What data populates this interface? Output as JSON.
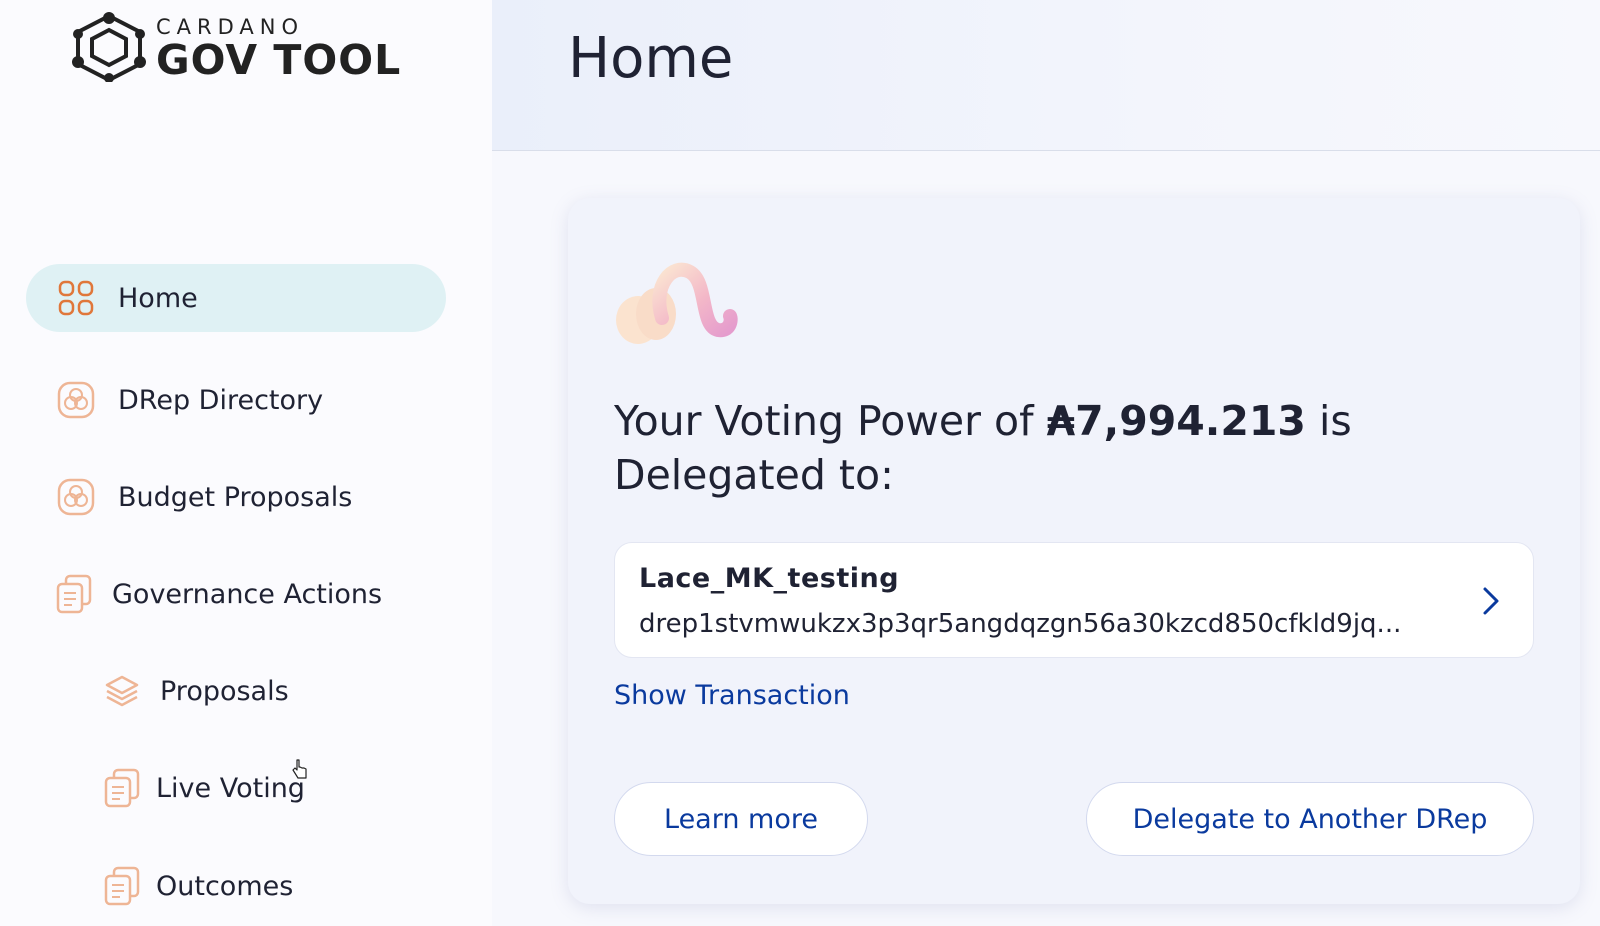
{
  "logo": {
    "small": "CARDANO",
    "big": "GOV TOOL"
  },
  "sidebar": {
    "items": [
      {
        "label": "Home",
        "icon": "dashboard-grid-icon",
        "active": true
      },
      {
        "label": "DRep Directory",
        "icon": "drep-circles-icon"
      },
      {
        "label": "Budget Proposals",
        "icon": "budget-circles-icon"
      },
      {
        "label": "Governance Actions",
        "icon": "document-icon"
      },
      {
        "label": "Proposals",
        "icon": "layers-icon"
      },
      {
        "label": "Live Voting",
        "icon": "document-icon"
      },
      {
        "label": "Outcomes",
        "icon": "document-icon"
      }
    ]
  },
  "header": {
    "title": "Home"
  },
  "card": {
    "power_prefix": "Your Voting Power of ",
    "power_amount": "₳7,994.213",
    "power_suffix": " is Delegated to:",
    "drep_name": "Lace_MK_testing",
    "drep_id": "drep1stvmwukzx3p3qr5angdqzgn56a30kzcd850cfkld9jq...",
    "show_transaction": "Show Transaction",
    "learn_more": "Learn more",
    "delegate_button": "Delegate to Another DRep"
  },
  "colors": {
    "accent_orange": "#e0773a",
    "link_blue": "#0a3a9e",
    "active_bg": "#dff1f4"
  }
}
